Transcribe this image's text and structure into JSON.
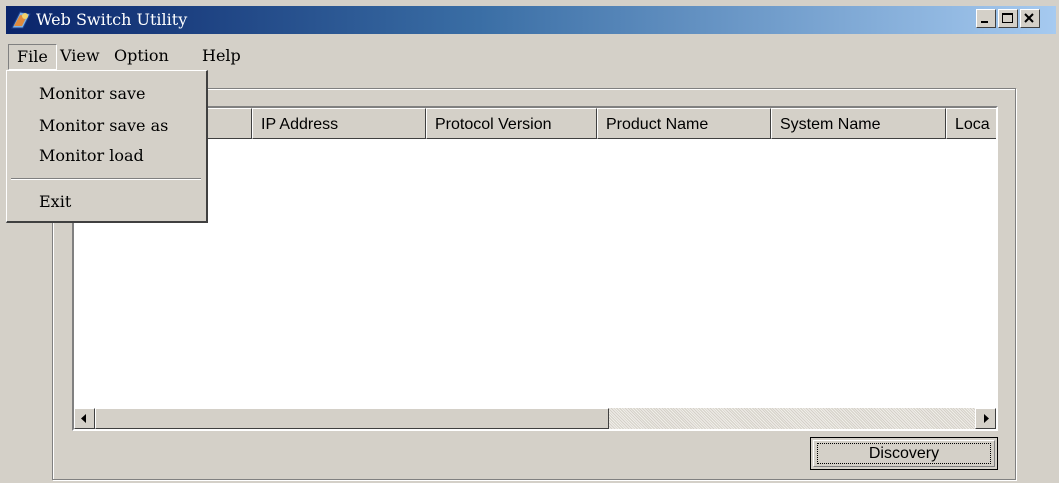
{
  "window": {
    "title": "Web Switch Utility"
  },
  "menubar": {
    "items": [
      {
        "label": "File",
        "active": true
      },
      {
        "label": "View"
      },
      {
        "label": "Option"
      },
      {
        "label": "Help"
      }
    ]
  },
  "file_menu": {
    "items": [
      {
        "label": "Monitor save"
      },
      {
        "label": "Monitor save as"
      },
      {
        "label": "Monitor load"
      },
      {
        "label": "Exit"
      }
    ]
  },
  "device_list": {
    "columns": [
      {
        "label": ""
      },
      {
        "label": "IP Address"
      },
      {
        "label": "Protocol Version"
      },
      {
        "label": "Product Name"
      },
      {
        "label": "System Name"
      },
      {
        "label": "Loca"
      }
    ],
    "rows": []
  },
  "buttons": {
    "discovery": "Discovery"
  },
  "icons": {
    "app": "app-icon",
    "minimize": "minimize-icon",
    "maximize": "maximize-icon",
    "close": "close-icon",
    "scroll_left": "arrow-left-icon",
    "scroll_right": "arrow-right-icon"
  },
  "colors": {
    "title_start": "#0a246a",
    "title_end": "#a6caf0",
    "face": "#d4d0c8"
  }
}
